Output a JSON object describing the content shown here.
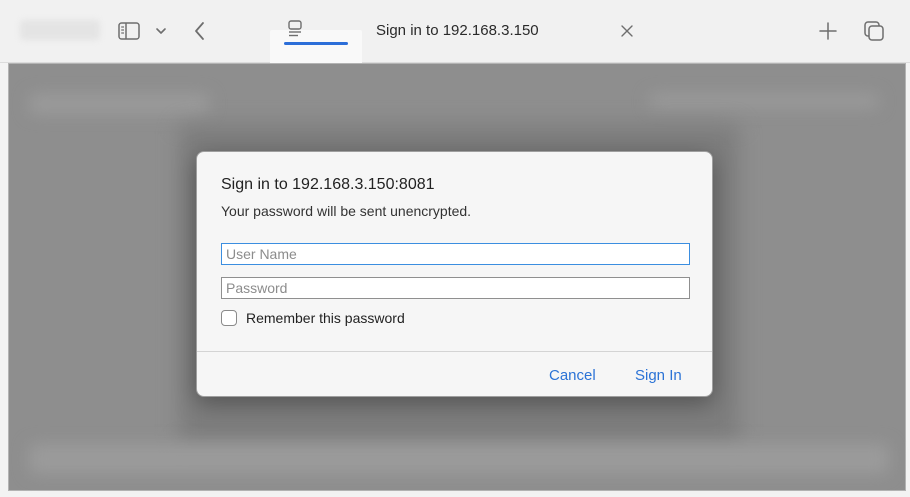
{
  "toolbar": {
    "tab_title": "Sign in to 192.168.3.150",
    "icons": [
      "sidebar-icon",
      "chevron-down-icon",
      "back-icon",
      "page-icon",
      "close-icon",
      "plus-icon",
      "tabs-overview-icon"
    ]
  },
  "dialog": {
    "title": "Sign in to 192.168.3.150:8081",
    "subtitle": "Your password will be sent unencrypted.",
    "username_placeholder": "User Name",
    "username_value": "",
    "password_placeholder": "Password",
    "password_value": "",
    "remember_label": "Remember this password",
    "remember_checked": false,
    "cancel_label": "Cancel",
    "signin_label": "Sign In"
  },
  "colors": {
    "accent": "#2b73d6",
    "focus_ring": "#3b8ee0",
    "backdrop": "#8e8e8e"
  }
}
